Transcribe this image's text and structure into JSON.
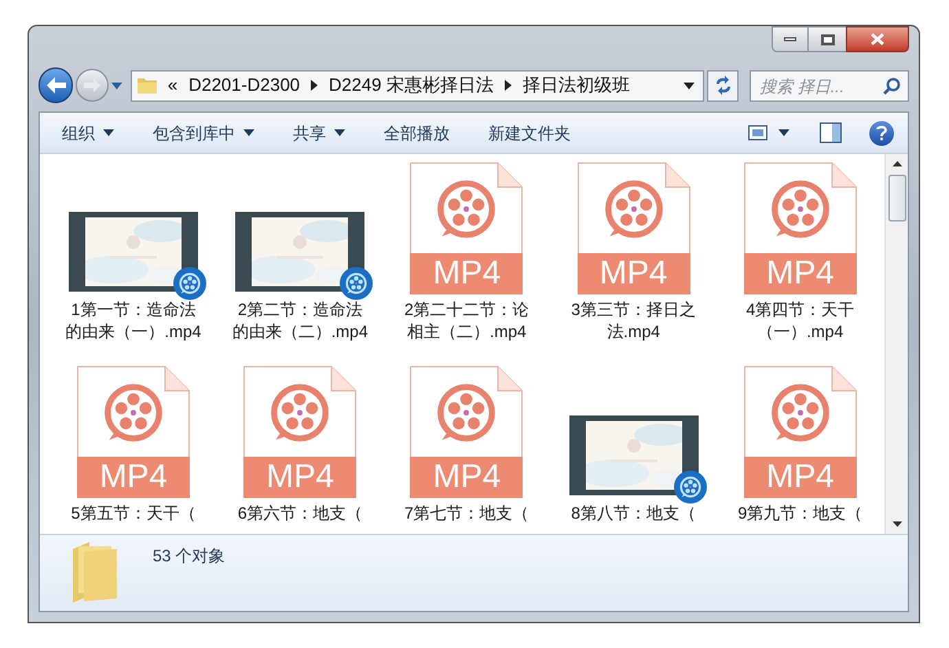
{
  "address": {
    "overflow": "«",
    "crumbs": [
      "D2201-D2300",
      "D2249 宋惠彬择日法",
      "择日法初级班"
    ]
  },
  "search": {
    "placeholder": "搜索 择日..."
  },
  "toolbar": [
    {
      "label": "组织",
      "dropdown": true
    },
    {
      "label": "包含到库中",
      "dropdown": true
    },
    {
      "label": "共享",
      "dropdown": true
    },
    {
      "label": "全部播放",
      "dropdown": false
    },
    {
      "label": "新建文件夹",
      "dropdown": false
    }
  ],
  "files": [
    {
      "kind": "video",
      "name": "1第一节：造命法的由来（一）.mp4"
    },
    {
      "kind": "video",
      "name": "2第二节：造命法的由来（二）.mp4"
    },
    {
      "kind": "mp4",
      "type_label": "MP4",
      "name": "2第二十二节：论相主（二）.mp4"
    },
    {
      "kind": "mp4",
      "type_label": "MP4",
      "name": "3第三节：择日之法.mp4"
    },
    {
      "kind": "mp4",
      "type_label": "MP4",
      "name": "4第四节：天干（一）.mp4"
    },
    {
      "kind": "mp4",
      "type_label": "MP4",
      "name": "5第五节：天干（"
    },
    {
      "kind": "mp4",
      "type_label": "MP4",
      "name": "6第六节：地支（"
    },
    {
      "kind": "mp4",
      "type_label": "MP4",
      "name": "7第七节：地支（"
    },
    {
      "kind": "video",
      "name": "8第八节：地支（"
    },
    {
      "kind": "mp4",
      "type_label": "MP4",
      "name": "9第九节：地支（"
    }
  ],
  "status_bar": {
    "count": "53 个对象"
  }
}
